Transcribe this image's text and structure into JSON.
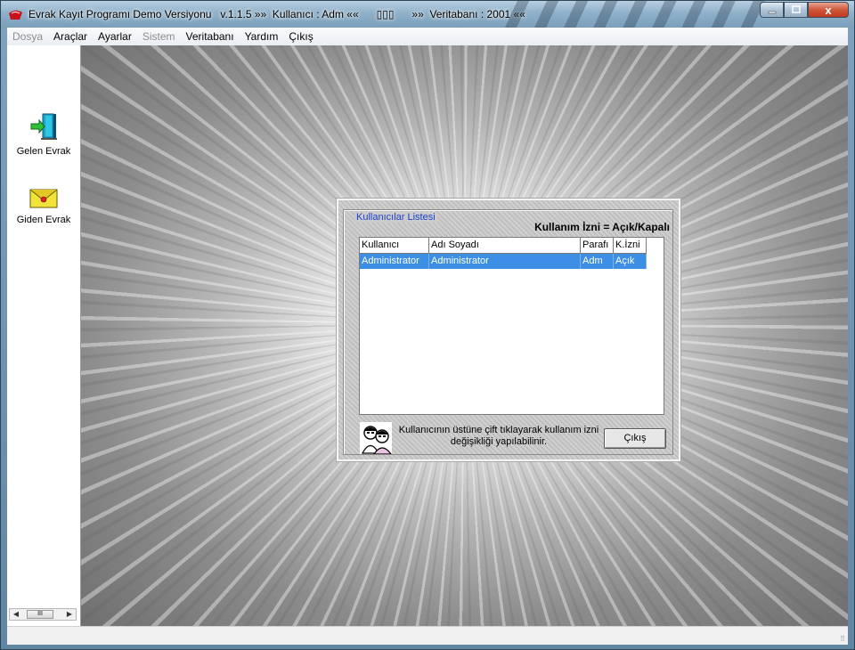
{
  "window": {
    "title": "Evrak Kayıt Programı Demo Versiyonu   v.1.1.5 »»  Kullanıcı : Adm ««      ▯▯▯      »»  Veritabanı : 2001 ««",
    "close_glyph": "x"
  },
  "menu": [
    {
      "label": "Dosya",
      "enabled": false
    },
    {
      "label": "Araçlar",
      "enabled": true
    },
    {
      "label": "Ayarlar",
      "enabled": true
    },
    {
      "label": "Sistem",
      "enabled": false
    },
    {
      "label": "Veritabanı",
      "enabled": true
    },
    {
      "label": "Yardım",
      "enabled": true
    },
    {
      "label": "Çıkış",
      "enabled": true
    }
  ],
  "sidebar": {
    "items": [
      {
        "label": "Gelen Evrak",
        "icon": "incoming-door-icon"
      },
      {
        "label": "Giden Evrak",
        "icon": "envelope-icon"
      }
    ],
    "scroll_thumb": "III"
  },
  "dialog": {
    "group_title": "Kullanıcılar Listesi",
    "permission_label": "Kullanım İzni = Açık/Kapalı",
    "columns": [
      "Kullanıcı",
      "Adı Soyadı",
      "Parafı",
      "K.İzni"
    ],
    "rows": [
      [
        "Administrator",
        "Administrator",
        "Adm",
        "Açık"
      ]
    ],
    "hint_line1": "Kullanıcının üstüne çift tıklayarak kullanım izni",
    "hint_line2": "değişikliği yapılabilinir.",
    "exit_button": "Çıkış"
  },
  "colors": {
    "selection": "#3d8ee5",
    "group_title": "#1c3fd0"
  }
}
